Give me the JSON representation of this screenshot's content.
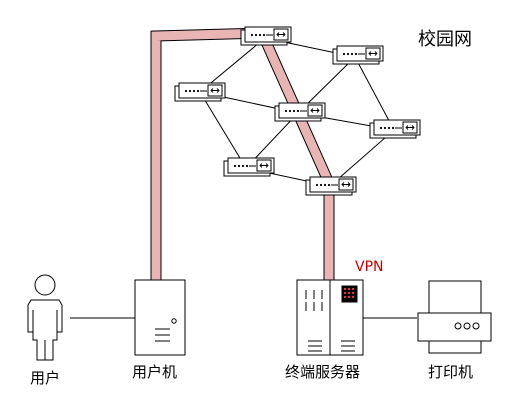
{
  "labels": {
    "campus_network": "校园网",
    "user": "用户",
    "user_computer": "用户机",
    "terminal_server": "终端服务器",
    "printer": "打印机",
    "vpn": "VPN"
  },
  "colors": {
    "vpn_tunnel_fill": "#e8b4b4",
    "vpn_label": "#cc0000",
    "stroke": "#000000"
  },
  "icons": {
    "router": "router-icon",
    "user": "person-icon",
    "computer": "computer-tower-icon",
    "server": "server-rack-icon",
    "printer": "printer-icon"
  }
}
